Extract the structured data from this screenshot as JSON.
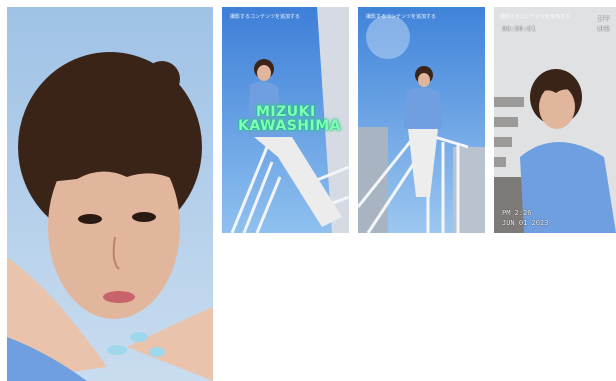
{
  "photos": [
    {
      "id": "photo-closeup",
      "alt": ""
    },
    {
      "id": "photo-stairs-title",
      "overlay_caption": "撮影するコンテンツを追加する",
      "title_line1": "MIZUKI",
      "title_line2": "KAWASHIMA"
    },
    {
      "id": "photo-stairs-pose",
      "overlay_caption": "撮影するコンテンツを追加する"
    },
    {
      "id": "photo-vhs",
      "overlay_caption": "撮影するコンテンツを追加する",
      "vhs_timecode": "00:00:01",
      "vhs_mode": "IFF",
      "vhs_format": "UHS",
      "vhs_time": "PM 2:26",
      "vhs_date": "JUN 01 2023"
    }
  ],
  "colors": {
    "sky": "#5aa2e8",
    "shirt": "#6f9fe0",
    "hair": "#3a2418",
    "skin": "#e2b69c",
    "title": "#7fffb4"
  }
}
